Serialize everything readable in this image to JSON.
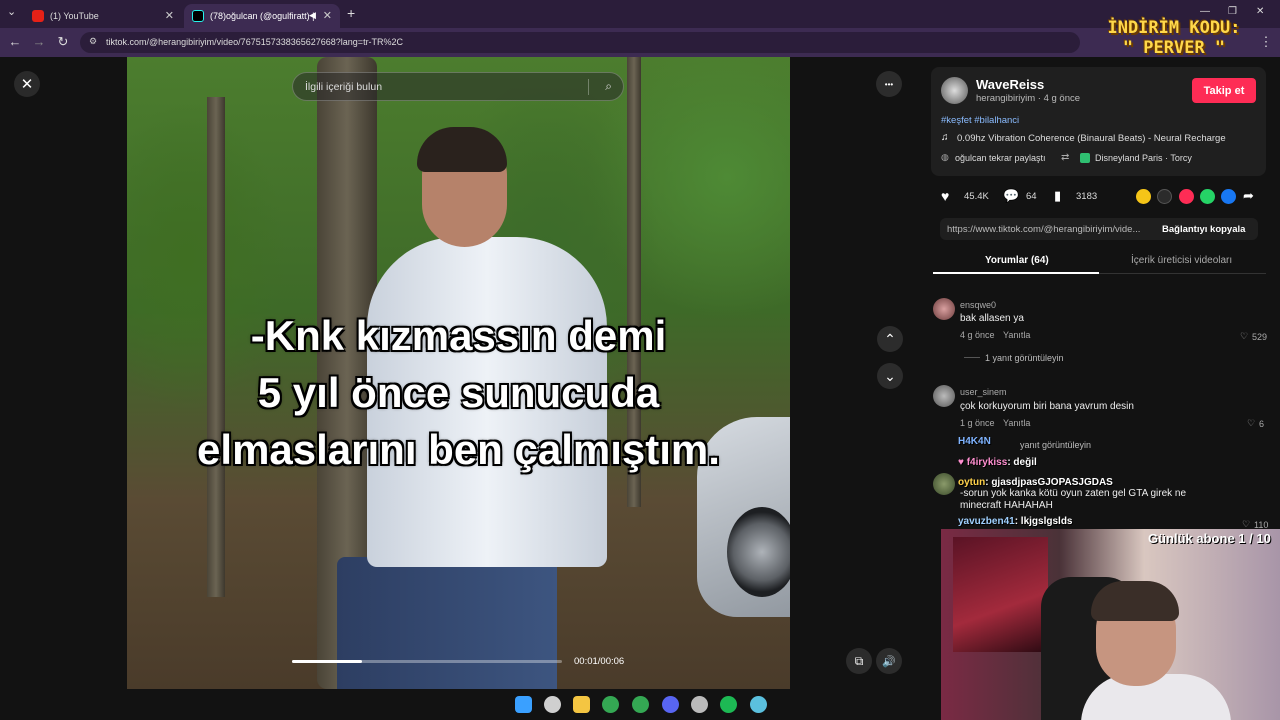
{
  "browser": {
    "tabs": [
      {
        "label": "(1) YouTube",
        "close": "✕"
      },
      {
        "label": "(78)oğulcan (@ogulfiratt) |",
        "close": "✕"
      }
    ],
    "new_tab": "+",
    "window_min": "—",
    "window_max": "❐",
    "window_close": "✕",
    "url": "tiktok.com/@herangibiriyim/video/7675157338365627668?lang=tr-TR%2C",
    "back": "←",
    "forward": "→",
    "reload": "↻",
    "menu": "⋮",
    "tab_list": "⌄"
  },
  "video": {
    "close": "✕",
    "search_placeholder": "İlgili içeriği bulun",
    "more": "•••",
    "subtitle_lines": [
      "-Knk kızmassın demi",
      "5 yıl önce sunucuda",
      "elmaslarını ben çalmıştım."
    ],
    "progress": 0.26,
    "timecode": "00:01/00:06",
    "nav_up": "⌃",
    "nav_down": "⌄",
    "volume": "🔊",
    "pip": "⧉"
  },
  "creator": {
    "name": "WaveReiss",
    "handle_time": "herangibiriyim · 4 g önce",
    "follow_label": "Takip et",
    "hashtags": "#keşfet #bilalhanci",
    "music": "0.09hz Vibration Coherence (Binaural Beats) - Neural Recharge",
    "repost": "oğulcan tekrar paylaştı",
    "location": "Disneyland Paris · Torcy"
  },
  "stats": {
    "likes": "45.4K",
    "comments": "64",
    "saves": "3183"
  },
  "share_colors": [
    "#f5c518",
    "#2b2b2b",
    "#fe2c55",
    "#25d366",
    "#1877f2"
  ],
  "share_forward": "➦",
  "link": {
    "url": "https://www.tiktok.com/@herangibiriyim/vide...",
    "copy_label": "Bağlantıyı kopyala"
  },
  "panel_tabs": [
    {
      "label": "Yorumlar (64)"
    },
    {
      "label": "İçerik üreticisi videoları"
    }
  ],
  "comments": [
    {
      "user": "ensqwe0",
      "text": "bak allasen ya",
      "time": "4 g önce",
      "reply": "Yanıtla",
      "likes": "529",
      "replies": "1 yanıt görüntüleyin"
    },
    {
      "user": "user_sinem",
      "text": "çok korkuyorum biri bana yavrum desin",
      "time": "1 g önce",
      "reply": "Yanıtla",
      "likes": "6",
      "replies": "yanıt görüntüleyin"
    },
    {
      "user": "",
      "text": "-sorun yok kanka kötü oyun zaten gel GTA girek ne minecraft HAHAHAH",
      "likes": "110"
    }
  ],
  "overlay": {
    "promo_line1": "İNDİRİM KODU:",
    "promo_line2": "\" PERVER \"",
    "chat": [
      {
        "user": "H4K4N",
        "msg": "",
        "color": "#7fb3ff"
      },
      {
        "user": "f4irykiss",
        "msg": ": değil",
        "color": "#ff8fd0"
      },
      {
        "user": "oytun",
        "msg": ": gjasdjpasGJOPASJGDAS",
        "color": "#ffd24a"
      },
      {
        "user": "yavuzben41",
        "msg": ": lkjgslgslds",
        "color": "#9fd0ff"
      }
    ],
    "sub_goal": "Günlük abone 1 / 10"
  },
  "taskbar_colors": [
    "#3aa0ff",
    "#cfcfcf",
    "#f4c542",
    "#34a853",
    "#34a853",
    "#5865f2",
    "#bbbbbb",
    "#1db954",
    "#5bc0de"
  ]
}
